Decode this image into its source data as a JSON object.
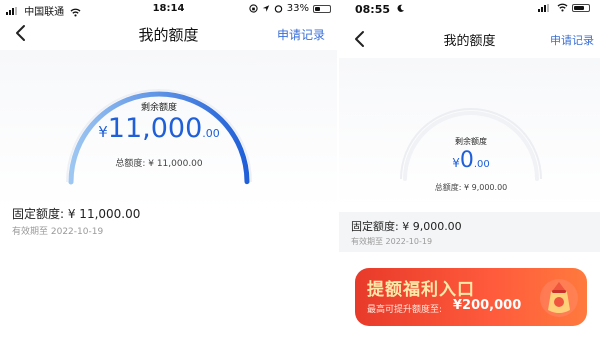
{
  "left": {
    "status": {
      "carrier": "中国联通",
      "time": "18:14",
      "battery": "33%"
    },
    "nav": {
      "title": "我的额度",
      "link": "申请记录"
    },
    "gauge": {
      "label": "剩余额度",
      "currency": "¥",
      "amount": "11,000",
      "decimals": ".00",
      "total": "总额度: ¥ 11,000.00",
      "fill_fraction": 1.0
    },
    "fixed_label": "固定额度: ¥ 11,000.00",
    "valid_label": "有效期至 2022-10-19"
  },
  "right": {
    "status": {
      "time": "08:55"
    },
    "nav": {
      "title": "我的额度",
      "link": "申请记录"
    },
    "gauge": {
      "label": "剩余额度",
      "currency": "¥",
      "amount": "0",
      "decimals": ".00",
      "total": "总额度: ¥ 9,000.00",
      "fill_fraction": 0.0
    },
    "fixed_label": "固定额度: ¥ 9,000.00",
    "valid_label": "有效期至 2022-10-19",
    "banner": {
      "title": "提额福利入口",
      "subtitle": "最高可提升额度至:",
      "amount": "¥200,000"
    }
  },
  "colors": {
    "accent": "#1f5fd8",
    "link": "#3a6fd8",
    "banner": "#ff4b2e"
  },
  "icons": {
    "back": "chevron-left-icon",
    "wifi": "wifi-icon",
    "signal": "signal-bars-icon",
    "battery": "battery-icon",
    "moon": "moon-icon",
    "gift_bag": "lucky-bag-icon"
  }
}
